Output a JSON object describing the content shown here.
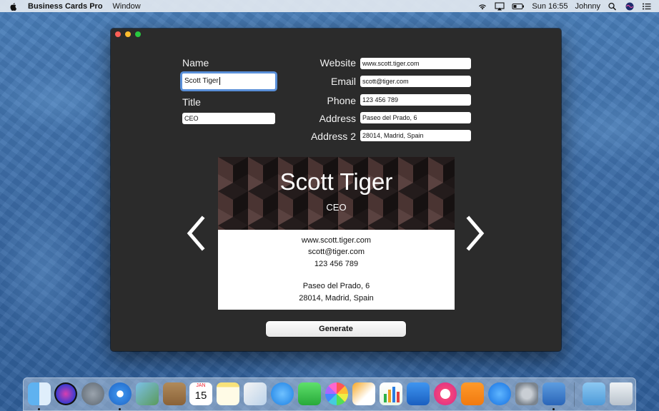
{
  "menubar": {
    "app_name": "Business Cards Pro",
    "menus": [
      "Window"
    ],
    "clock": "Sun 16:55",
    "user": "Johnny"
  },
  "form": {
    "name_label": "Name",
    "name_value": "Scott Tiger",
    "title_label": "Title",
    "title_value": "CEO",
    "website_label": "Website",
    "website_value": "www.scott.tiger.com",
    "email_label": "Email",
    "email_value": "scott@tiger.com",
    "phone_label": "Phone",
    "phone_value": "123 456 789",
    "address_label": "Address",
    "address_value": "Paseo del Prado, 6",
    "address2_label": "Address 2",
    "address2_value": "28014, Madrid, Spain"
  },
  "card": {
    "name": "Scott Tiger",
    "title": "CEO",
    "website": "www.scott.tiger.com",
    "email": "scott@tiger.com",
    "phone": "123 456 789",
    "address": "Paseo del Prado, 6",
    "address2": "28014, Madrid, Spain"
  },
  "buttons": {
    "generate": "Generate"
  },
  "dock": {
    "calendar_month": "JAN",
    "calendar_day": "15",
    "items": [
      "finder",
      "siri",
      "launchpad",
      "safari",
      "preview",
      "notes-book",
      "calendar",
      "notes",
      "photo-browser",
      "messages",
      "facetime",
      "photos",
      "keynote-doc",
      "numbers",
      "keynote",
      "itunes",
      "ibooks",
      "app-store",
      "system-preferences",
      "directory-utility",
      "downloads",
      "trash"
    ]
  }
}
